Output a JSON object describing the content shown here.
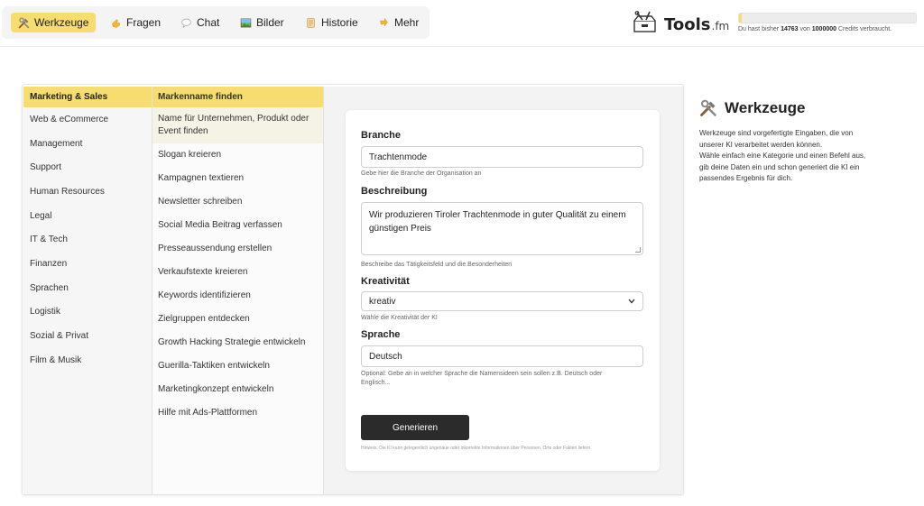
{
  "nav": {
    "items": [
      {
        "label": "Werkzeuge",
        "icon": "tools-icon",
        "active": true
      },
      {
        "label": "Fragen",
        "icon": "pointing-hand-icon",
        "active": false
      },
      {
        "label": "Chat",
        "icon": "speech-bubble-icon",
        "active": false
      },
      {
        "label": "Bilder",
        "icon": "picture-icon",
        "active": false
      },
      {
        "label": "Historie",
        "icon": "scroll-icon",
        "active": false
      },
      {
        "label": "Mehr",
        "icon": "pointing-hand-icon",
        "active": false
      }
    ]
  },
  "brand": {
    "name": "Tools",
    "suffix": ".fm",
    "logo_icon": "toolbox-logo-icon"
  },
  "credits": {
    "prefix": "Du hast bisher",
    "used": "14763",
    "mid": "von",
    "total": "1000000",
    "suffix": "Credits verbraucht.",
    "used_fraction": 0.0148
  },
  "categories": [
    {
      "label": "Marketing & Sales",
      "active": true
    },
    {
      "label": "Web & eCommerce"
    },
    {
      "label": "Management"
    },
    {
      "label": "Support"
    },
    {
      "label": "Human Resources"
    },
    {
      "label": "Legal"
    },
    {
      "label": "IT & Tech"
    },
    {
      "label": "Finanzen"
    },
    {
      "label": "Sprachen"
    },
    {
      "label": "Logistik"
    },
    {
      "label": "Sozial & Privat"
    },
    {
      "label": "Film & Musik"
    }
  ],
  "tools": [
    {
      "label": "Markenname finden",
      "active": true
    },
    {
      "label": "Name für Unternehmen, Produkt oder Event finden",
      "hover": true
    },
    {
      "label": "Slogan kreieren"
    },
    {
      "label": "Kampagnen textieren"
    },
    {
      "label": "Newsletter schreiben"
    },
    {
      "label": "Social Media Beitrag verfassen"
    },
    {
      "label": "Presseaussendung erstellen"
    },
    {
      "label": "Verkaufstexte kreieren"
    },
    {
      "label": "Keywords identifizieren"
    },
    {
      "label": "Zielgruppen entdecken"
    },
    {
      "label": "Growth Hacking Strategie entwickeln"
    },
    {
      "label": "Guerilla-Taktiken entwickeln"
    },
    {
      "label": "Marketingkonzept entwickeln"
    },
    {
      "label": "Hilfe mit Ads-Plattformen"
    }
  ],
  "form": {
    "branche": {
      "label": "Branche",
      "value": "Trachtenmode",
      "help": "Gebe hier die Branche der Organisation an"
    },
    "beschreibung": {
      "label": "Beschreibung",
      "value": "Wir produzieren Tiroler Trachtenmode in guter Qualität zu einem günstigen Preis",
      "help": "Beschreibe das Tätigkeitsfeld und die Besonderheiten"
    },
    "kreativitaet": {
      "label": "Kreativität",
      "value": "kreativ",
      "help": "Wähle die Kreativität der KI"
    },
    "sprache": {
      "label": "Sprache",
      "value": "Deutsch",
      "help": "Optional: Gebe an in welcher Sprache die Namensideen sein sollen z.B. Deutsch oder Englisch..."
    },
    "submit_label": "Generieren",
    "note": "Hinweis: Die KI kann gelegentlich ungenaue oder inkorrekte Informationen über Personen, Orte oder Fakten liefern."
  },
  "info": {
    "title": "Werkzeuge",
    "icon": "tools-icon",
    "lines": [
      "Werkzeuge sind vorgefertigte Eingaben, die von",
      "unserer KI verarbeitet werden können.",
      "Wähle einfach eine Kategorie und einen Befehl aus,",
      "gib deine Daten ein und schon generiert die KI ein",
      "passendes Ergebnis für dich."
    ]
  },
  "colors": {
    "accent": "#f7dc6f",
    "button": "#2b2b2b"
  }
}
